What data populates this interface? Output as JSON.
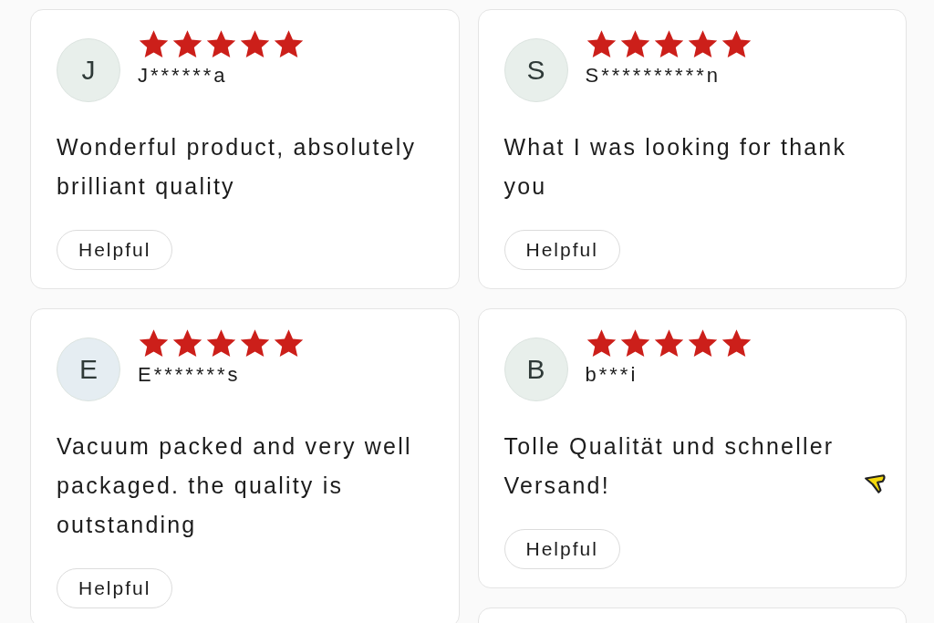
{
  "columns": [
    {
      "reviews": [
        {
          "initial": "J",
          "color": "#e8efeb",
          "stars": 5,
          "name": "J******a",
          "text": "Wonderful product, absolutely brilliant quality",
          "helpful": "Helpful",
          "pointer": false
        },
        {
          "initial": "E",
          "color": "#e5edf2",
          "stars": 5,
          "name": "E*******s",
          "text": "Vacuum packed and very well packaged. the quality is outstanding",
          "helpful": "Helpful",
          "pointer": false
        }
      ]
    },
    {
      "reviews": [
        {
          "initial": "S",
          "color": "#e8efeb",
          "stars": 5,
          "name": "S**********n",
          "text": "What I was looking for thank you",
          "helpful": "Helpful",
          "pointer": false
        },
        {
          "initial": "B",
          "color": "#e8efeb",
          "stars": 5,
          "name": "b***i",
          "text": "Tolle Qualität und schneller Versand!",
          "helpful": "Helpful",
          "pointer": true
        }
      ]
    }
  ]
}
